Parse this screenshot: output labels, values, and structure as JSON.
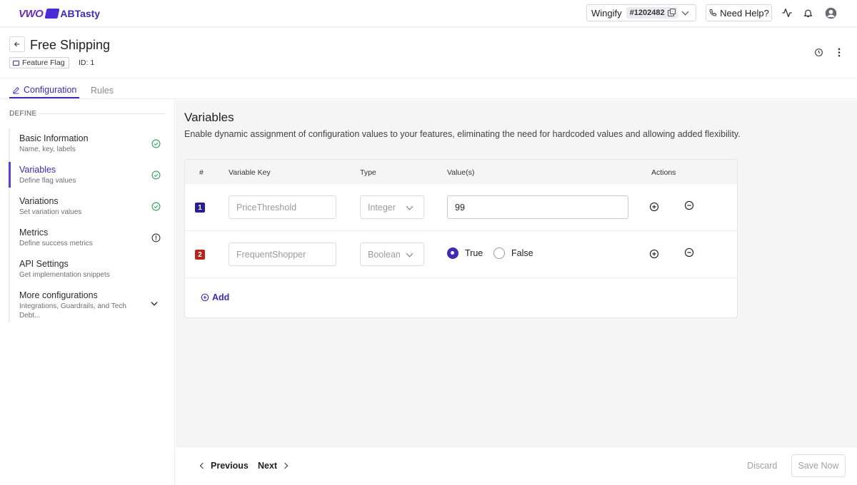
{
  "brand": {
    "vwo": "VWO",
    "abtasty": "ABTasty",
    "color": "#3d2bb8"
  },
  "topbar": {
    "account_name": "Wingify",
    "account_id": "#1202482",
    "help_label": "Need Help?"
  },
  "header": {
    "title": "Free Shipping",
    "badge": "Feature Flag",
    "id_label": "ID: 1"
  },
  "tabs": [
    {
      "label": "Configuration",
      "active": true
    },
    {
      "label": "Rules",
      "active": false
    }
  ],
  "sidebar": {
    "section_label": "DEFINE",
    "items": [
      {
        "title": "Basic Information",
        "subtitle": "Name, key, labels",
        "status": "complete"
      },
      {
        "title": "Variables",
        "subtitle": "Define flag values",
        "status": "complete",
        "active": true
      },
      {
        "title": "Variations",
        "subtitle": "Set variation values",
        "status": "complete"
      },
      {
        "title": "Metrics",
        "subtitle": "Define success metrics",
        "status": "info"
      },
      {
        "title": "API Settings",
        "subtitle": "Get implementation snippets",
        "status": "none"
      },
      {
        "title": "More configurations",
        "subtitle": "Integrations, Guardrails, and Tech Debt...",
        "status": "expand"
      }
    ]
  },
  "main": {
    "title": "Variables",
    "description": "Enable dynamic assignment of configuration values to your features, eliminating the need for hardcoded values and allowing added flexibility.",
    "columns": [
      "#",
      "Variable Key",
      "Type",
      "Value(s)",
      "Actions"
    ],
    "rows": [
      {
        "num": "1",
        "key_placeholder": "PriceThreshold",
        "type": "Integer",
        "value": "99",
        "num_color": "#2a1f8f"
      },
      {
        "num": "2",
        "key_placeholder": "FrequentShopper",
        "type": "Boolean",
        "options": [
          "True",
          "False"
        ],
        "selected": "True",
        "num_color": "#b3261e"
      }
    ],
    "add_label": "Add"
  },
  "footer": {
    "previous": "Previous",
    "next": "Next",
    "discard": "Discard",
    "save": "Save Now"
  }
}
